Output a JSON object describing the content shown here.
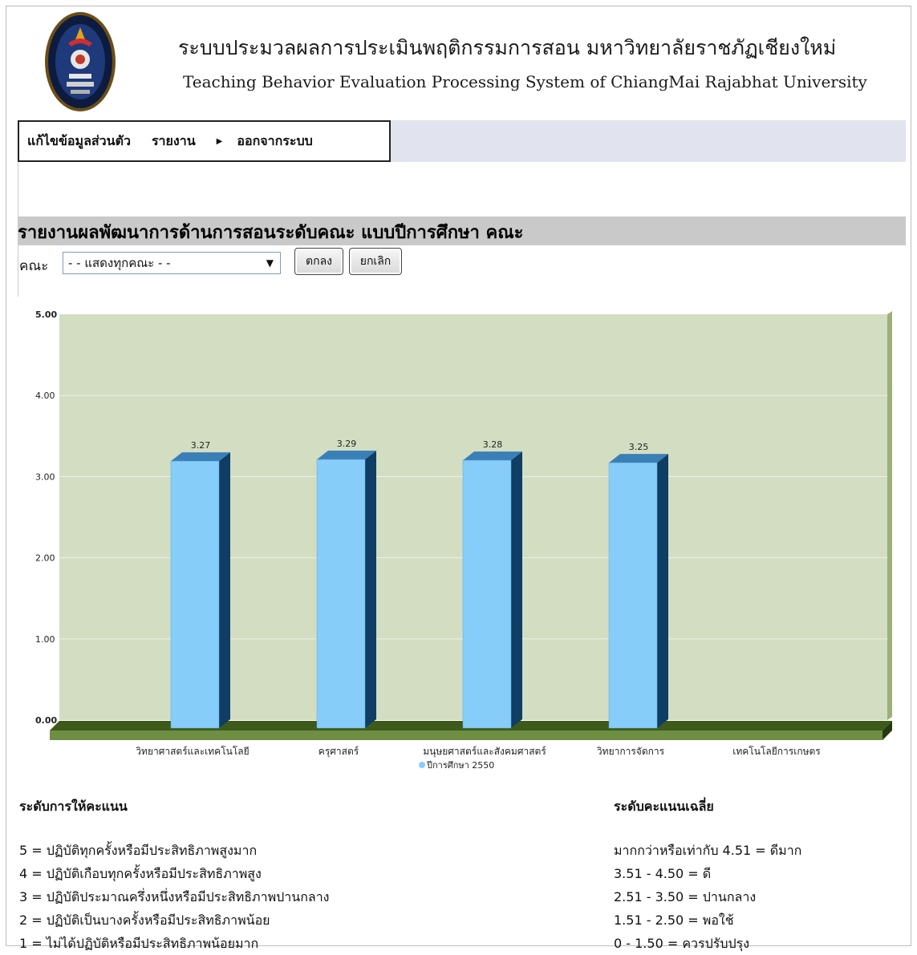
{
  "header": {
    "title_th": "ระบบประมวลผลการประเมินพฤติกรรมการสอน มหาวิทยาลัยราชภัฏเชียงใหม่",
    "title_en": "Teaching Behavior Evaluation Processing System of ChiangMai Rajabhat University"
  },
  "menu": {
    "edit_profile": "แก้ไขข้อมูลส่วนตัว",
    "report": "รายงาน",
    "logout": "ออกจากระบบ"
  },
  "report": {
    "title": "รายงานผลพัฒนาการด้านการสอนระดับคณะ แบบปีการศึกษา คณะ",
    "faculty_label": "คณะ",
    "faculty_selected": "- - แสดงทุกคณะ - -",
    "ok_button": "ตกลง",
    "cancel_button": "ยกเลิก"
  },
  "chart_data": {
    "type": "bar",
    "categories": [
      "วิทยาศาสตร์และเทคโนโลยี",
      "ครุศาสตร์",
      "มนุษยศาสตร์และสังคมศาสตร์",
      "วิทยาการจัดการ",
      "เทคโนโลยีการเกษตร"
    ],
    "series": [
      {
        "name": "ปีการศึกษา 2550",
        "values": [
          3.27,
          3.29,
          3.28,
          3.25,
          null
        ]
      }
    ],
    "data_labels": [
      "3.27",
      "3.29",
      "3.28",
      "3.25"
    ],
    "y_ticks": [
      "0.00",
      "1.00",
      "2.00",
      "3.00",
      "4.00",
      "5.00"
    ],
    "ylim": [
      0,
      5
    ],
    "grid": true,
    "legend_position": "bottom-center",
    "colors": {
      "bar": "#87cdfa",
      "bar_side": "#0f3d63",
      "bar_top": "#3a7fb6",
      "plot_bg": "#d3ddc2",
      "floor": "#6e8f43"
    }
  },
  "scoring": {
    "title": "ระดับการให้คะแนน",
    "items": [
      "5 = ปฏิบัติทุกครั้งหรือมีประสิทธิภาพสูงมาก",
      "4 = ปฏิบัติเกือบทุกครั้งหรือมีประสิทธิภาพสูง",
      "3 = ปฏิบัติประมาณครึ่งหนึ่งหรือมีประสิทธิภาพปานกลาง",
      "2 = ปฏิบัติเป็นบางครั้งหรือมีประสิทธิภาพน้อย",
      "1 = ไม่ได้ปฏิบัติหรือมีประสิทธิภาพน้อยมาก"
    ]
  },
  "average": {
    "title": "ระดับคะแนนเฉลี่ย",
    "items": [
      "มากกว่าหรือเท่ากับ 4.51 = ดีมาก",
      "3.51 - 4.50 = ดี",
      "2.51 - 3.50 = ปานกลาง",
      "1.51 - 2.50 = พอใช้",
      "0 - 1.50 = ควรปรับปรุง"
    ]
  }
}
